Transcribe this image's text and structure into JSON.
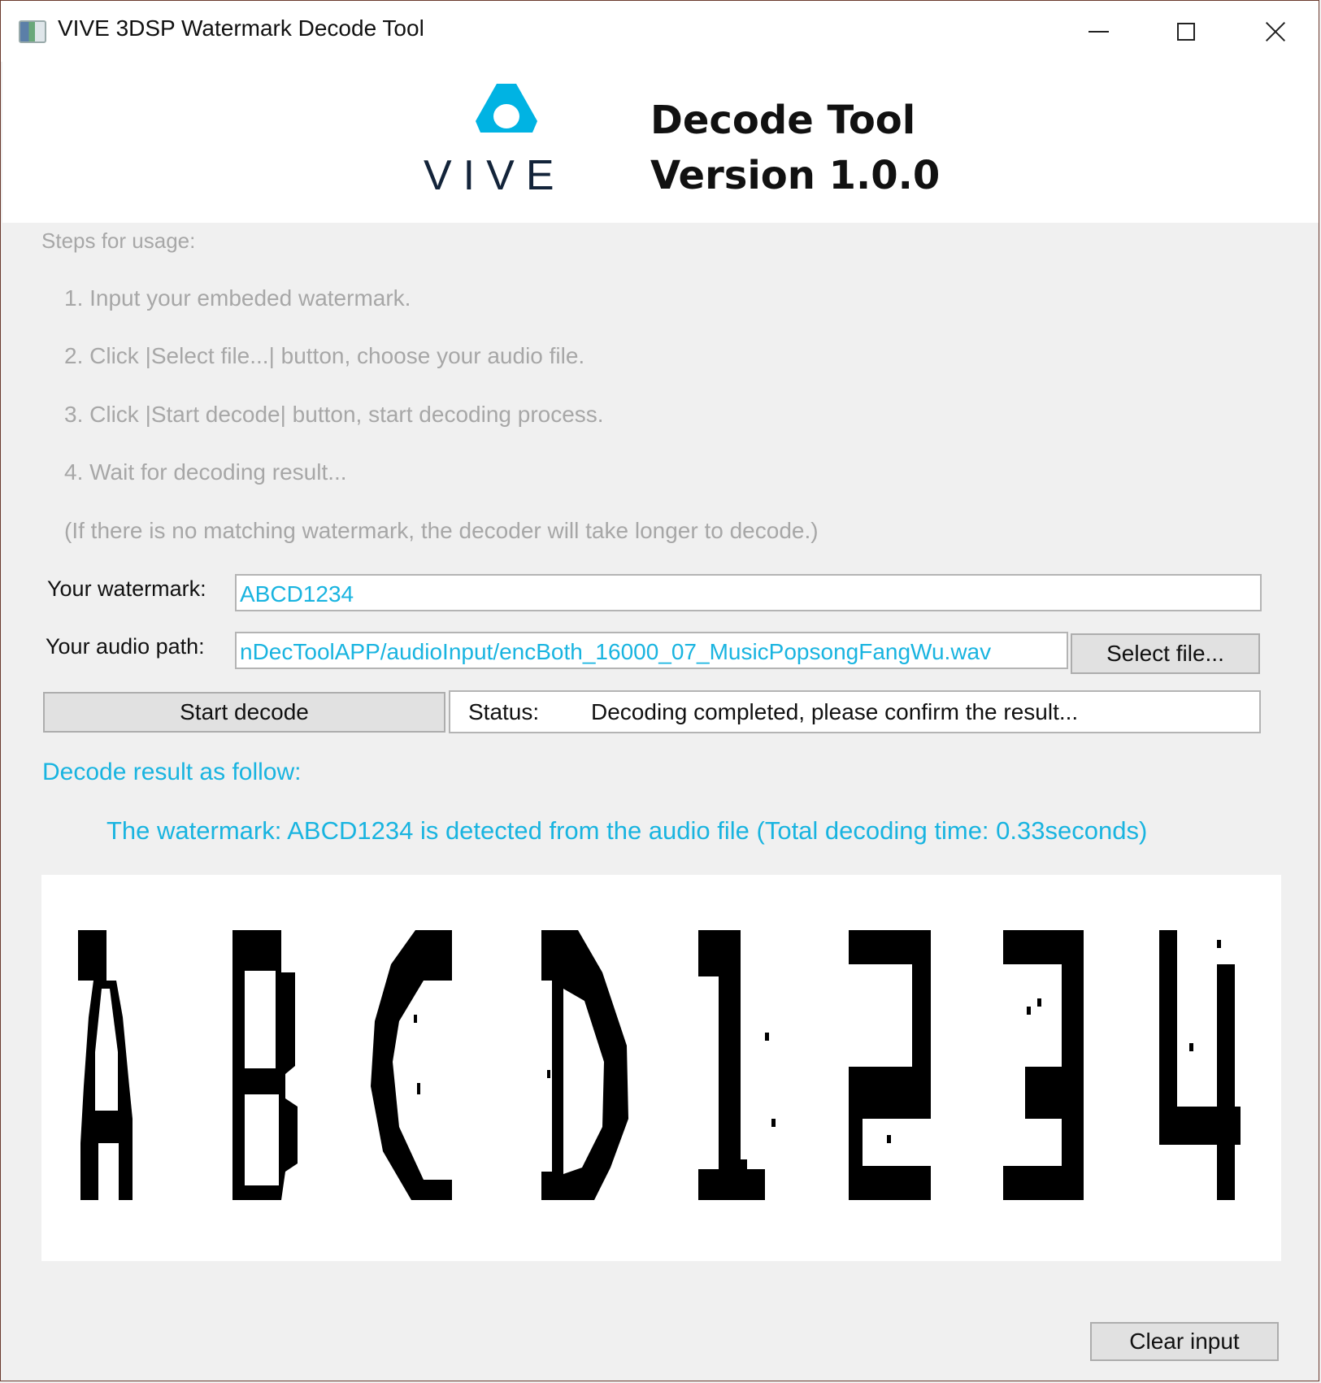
{
  "window": {
    "title": "VIVE 3DSP Watermark Decode Tool",
    "icons": {
      "app": "app-window-icon",
      "minimize": "minimize-icon",
      "maximize": "maximize-icon",
      "close": "close-icon"
    }
  },
  "header": {
    "logo_text": "VIVE",
    "logo_color": "#00b3e3",
    "title_line1": "Decode Tool",
    "title_line2": "Version 1.0.0"
  },
  "steps": {
    "title": "Steps for usage:",
    "items": [
      "1. Input your embeded watermark.",
      "2. Click |Select file...| button, choose your audio file.",
      "3. Click |Start decode| button, start decoding process.",
      "4. Wait for decoding result...",
      "(If there is no matching watermark, the decoder will take longer to decode.)"
    ]
  },
  "form": {
    "watermark_label": "Your watermark:",
    "watermark_value": "ABCD1234",
    "audio_label": "Your audio path:",
    "audio_value": "nDecToolAPP/audioInput/encBoth_16000_07_MusicPopsongFangWu.wav",
    "select_file_label": "Select file...",
    "start_decode_label": "Start decode",
    "status_label": "Status:",
    "status_text": "Decoding completed, please confirm the result..."
  },
  "result": {
    "heading": "Decode result as follow:",
    "message": "The watermark: ABCD1234 is detected from the audio file (Total decoding time: 0.33seconds)",
    "decoded_characters": [
      "A",
      "B",
      "C",
      "D",
      "1",
      "2",
      "3",
      "4"
    ],
    "accent_color": "#19b4e0"
  },
  "footer": {
    "clear_label": "Clear input"
  }
}
